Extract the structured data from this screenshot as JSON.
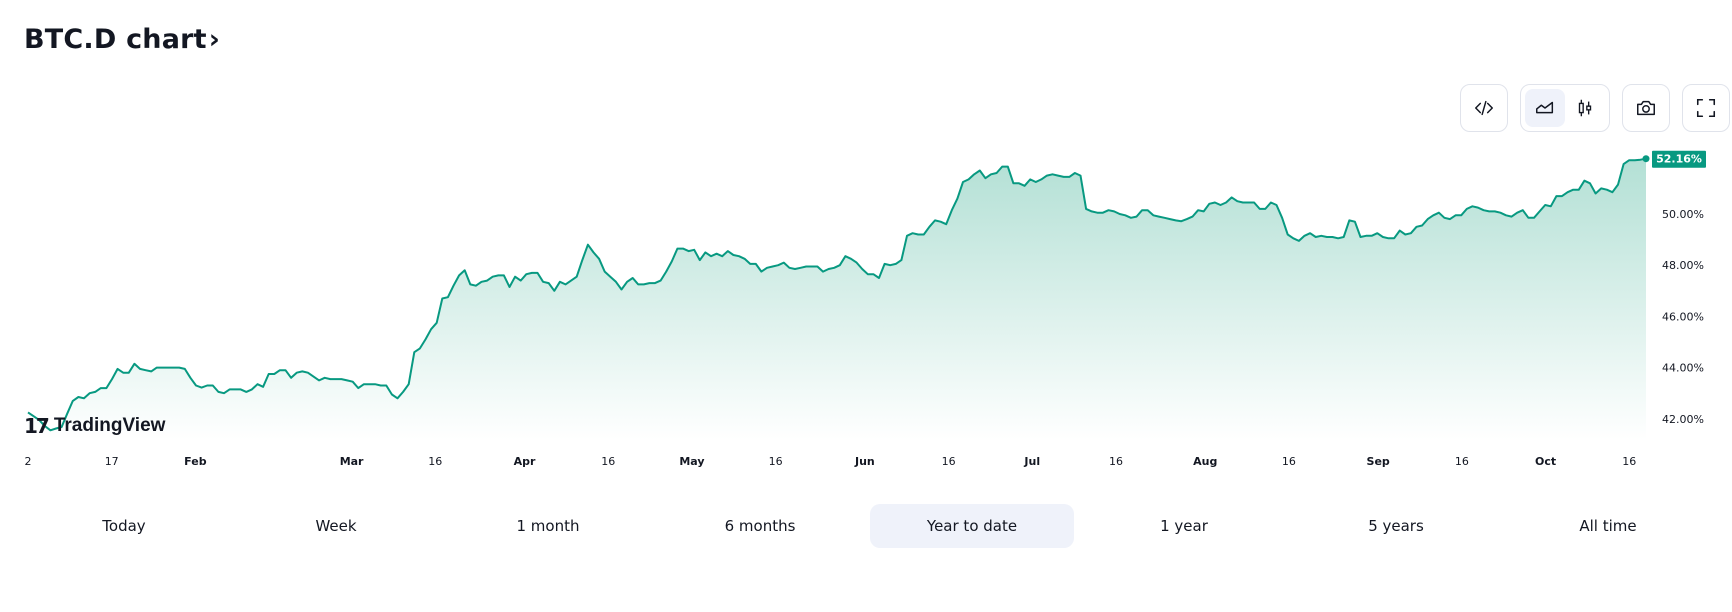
{
  "header": {
    "title": "BTC.D chart",
    "chevron": "›"
  },
  "toolbar": {
    "buttons": [
      {
        "name": "embed-code",
        "icon": "code-icon"
      },
      {
        "name": "area-chart",
        "icon": "area-chart-icon",
        "active": true
      },
      {
        "name": "candles",
        "icon": "candlestick-icon",
        "active": false
      },
      {
        "name": "snapshot",
        "icon": "camera-icon"
      },
      {
        "name": "fullscreen",
        "icon": "fullscreen-icon"
      }
    ]
  },
  "branding": {
    "logo_mark": "17",
    "logo_text": "TradingView"
  },
  "colors": {
    "line": "#089981",
    "fill_top": "#b6e2d8",
    "fill_bottom": "#ffffff",
    "selected_tab_bg": "#eff2fa"
  },
  "tabs": [
    {
      "label": "Today",
      "active": false
    },
    {
      "label": "Week",
      "active": false
    },
    {
      "label": "1 month",
      "active": false
    },
    {
      "label": "6 months",
      "active": false
    },
    {
      "label": "Year to date",
      "active": true
    },
    {
      "label": "1 year",
      "active": false
    },
    {
      "label": "5 years",
      "active": false
    },
    {
      "label": "All time",
      "active": false
    }
  ],
  "chart_data": {
    "type": "area",
    "title": "BTC.D chart",
    "xlabel": "",
    "ylabel": "",
    "ylim": [
      41.4,
      52.8
    ],
    "y_ticks": [
      "42.00%",
      "44.00%",
      "46.00%",
      "48.00%",
      "50.00%"
    ],
    "y_tick_values": [
      42,
      44,
      46,
      48,
      50
    ],
    "x_range_days": [
      0,
      290
    ],
    "x_ticks": [
      {
        "label": "2",
        "day": 0,
        "month": false
      },
      {
        "label": "17",
        "day": 15,
        "month": false
      },
      {
        "label": "Feb",
        "day": 30,
        "month": true
      },
      {
        "label": "Mar",
        "day": 58,
        "month": true
      },
      {
        "label": "16",
        "day": 73,
        "month": false
      },
      {
        "label": "Apr",
        "day": 89,
        "month": true
      },
      {
        "label": "16",
        "day": 104,
        "month": false
      },
      {
        "label": "May",
        "day": 119,
        "month": true
      },
      {
        "label": "16",
        "day": 134,
        "month": false
      },
      {
        "label": "Jun",
        "day": 150,
        "month": true
      },
      {
        "label": "16",
        "day": 165,
        "month": false
      },
      {
        "label": "Jul",
        "day": 180,
        "month": true
      },
      {
        "label": "16",
        "day": 195,
        "month": false
      },
      {
        "label": "Aug",
        "day": 211,
        "month": true
      },
      {
        "label": "16",
        "day": 226,
        "month": false
      },
      {
        "label": "Sep",
        "day": 242,
        "month": true
      },
      {
        "label": "16",
        "day": 257,
        "month": false
      },
      {
        "label": "Oct",
        "day": 272,
        "month": true
      },
      {
        "label": "16",
        "day": 287,
        "month": false
      }
    ],
    "last_value_label": "52.16%",
    "last_value": 52.16,
    "grid": false,
    "series": [
      {
        "name": "BTC.D",
        "values": [
          42.25,
          42.1,
          41.95,
          41.72,
          41.55,
          41.62,
          41.68,
          42.2,
          42.7,
          42.85,
          42.8,
          43.0,
          43.05,
          43.2,
          43.2,
          43.55,
          43.95,
          43.8,
          43.8,
          44.15,
          43.95,
          43.9,
          43.85,
          44.0,
          44.0,
          44.0,
          44.0,
          44.0,
          43.95,
          43.6,
          43.3,
          43.22,
          43.3,
          43.3,
          43.05,
          43.0,
          43.15,
          43.15,
          43.15,
          43.05,
          43.15,
          43.35,
          43.25,
          43.75,
          43.75,
          43.9,
          43.9,
          43.6,
          43.8,
          43.85,
          43.8,
          43.65,
          43.5,
          43.6,
          43.55,
          43.55,
          43.55,
          43.5,
          43.45,
          43.2,
          43.35,
          43.35,
          43.35,
          43.3,
          43.3,
          42.95,
          42.8,
          43.05,
          43.35,
          44.6,
          44.75,
          45.1,
          45.5,
          45.75,
          46.7,
          46.75,
          47.2,
          47.6,
          47.8,
          47.25,
          47.2,
          47.35,
          47.4,
          47.55,
          47.6,
          47.6,
          47.15,
          47.55,
          47.4,
          47.65,
          47.7,
          47.7,
          47.35,
          47.3,
          47.0,
          47.35,
          47.25,
          47.4,
          47.55,
          48.2,
          48.8,
          48.5,
          48.25,
          47.75,
          47.55,
          47.35,
          47.05,
          47.35,
          47.5,
          47.25,
          47.25,
          47.3,
          47.3,
          47.4,
          47.75,
          48.15,
          48.65,
          48.65,
          48.55,
          48.6,
          48.2,
          48.5,
          48.35,
          48.45,
          48.35,
          48.55,
          48.4,
          48.35,
          48.25,
          48.05,
          48.05,
          47.75,
          47.9,
          47.95,
          48.0,
          48.1,
          47.9,
          47.85,
          47.9,
          47.95,
          47.95,
          47.95,
          47.75,
          47.85,
          47.9,
          48.0,
          48.35,
          48.25,
          48.1,
          47.85,
          47.65,
          47.65,
          47.5,
          48.05,
          48.0,
          48.05,
          48.2,
          49.15,
          49.25,
          49.2,
          49.2,
          49.5,
          49.75,
          49.7,
          49.6,
          50.15,
          50.6,
          51.25,
          51.35,
          51.55,
          51.7,
          51.4,
          51.55,
          51.6,
          51.85,
          51.85,
          51.2,
          51.2,
          51.1,
          51.35,
          51.25,
          51.35,
          51.5,
          51.55,
          51.5,
          51.45,
          51.45,
          51.6,
          51.5,
          50.2,
          50.1,
          50.05,
          50.05,
          50.15,
          50.1,
          50.0,
          49.95,
          49.85,
          49.9,
          50.15,
          50.15,
          49.95,
          49.9,
          49.85,
          49.8,
          49.75,
          49.72,
          49.8,
          49.9,
          50.15,
          50.1,
          50.4,
          50.45,
          50.35,
          50.45,
          50.65,
          50.5,
          50.45,
          50.45,
          50.45,
          50.2,
          50.2,
          50.45,
          50.35,
          49.85,
          49.2,
          49.05,
          48.95,
          49.15,
          49.25,
          49.1,
          49.15,
          49.1,
          49.1,
          49.05,
          49.1,
          49.75,
          49.7,
          49.1,
          49.15,
          49.15,
          49.25,
          49.1,
          49.05,
          49.05,
          49.35,
          49.2,
          49.25,
          49.5,
          49.55,
          49.8,
          49.95,
          50.05,
          49.85,
          49.8,
          49.95,
          49.95,
          50.2,
          50.3,
          50.25,
          50.15,
          50.1,
          50.1,
          50.05,
          49.95,
          49.9,
          50.05,
          50.15,
          49.85,
          49.85,
          50.1,
          50.35,
          50.3,
          50.7,
          50.7,
          50.85,
          50.95,
          50.95,
          51.3,
          51.2,
          50.8,
          51.0,
          50.95,
          50.85,
          51.15,
          51.95,
          52.1,
          52.1,
          52.12,
          52.16
        ]
      }
    ]
  }
}
